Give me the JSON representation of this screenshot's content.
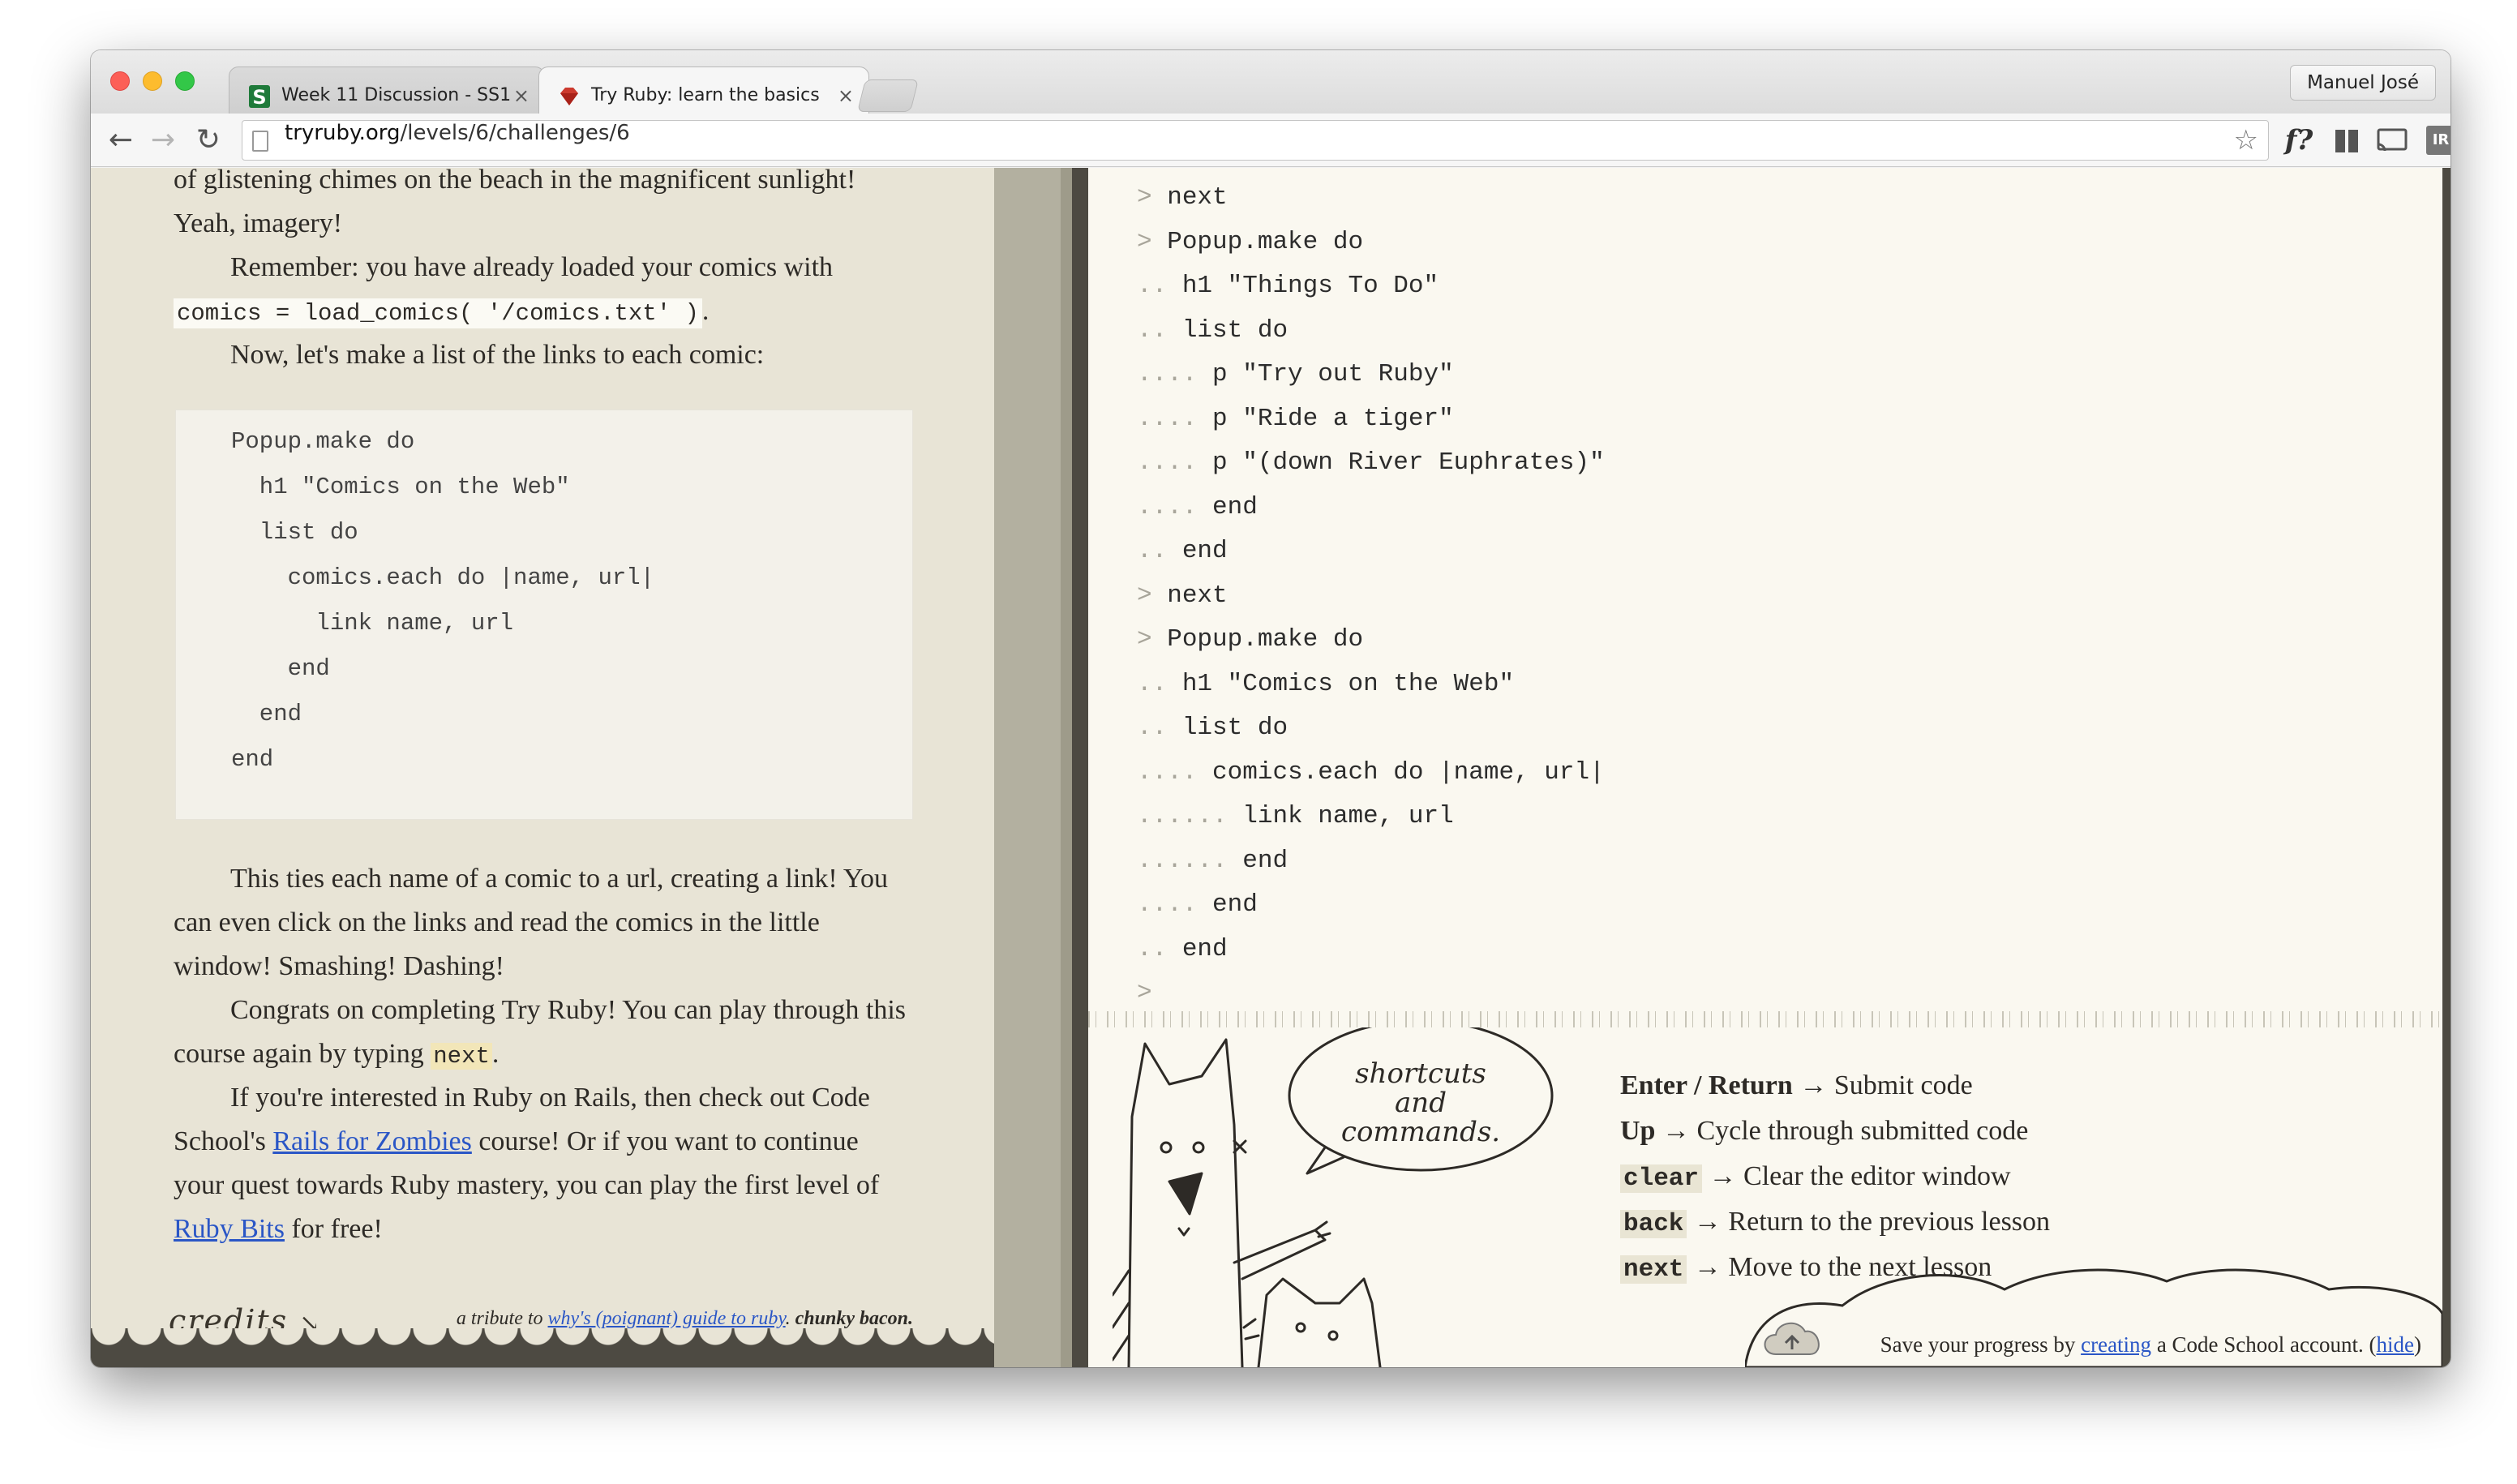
{
  "browser": {
    "tabs": [
      {
        "title": "Week 11 Discussion - SS1",
        "active": false
      },
      {
        "title": "Try Ruby: learn the basics",
        "active": true
      }
    ],
    "profile_name": "Manuel José",
    "url_domain": "tryruby.org",
    "url_path": "/levels/6/challenges/6",
    "ext_f": "f?",
    "ext_ir": "IR"
  },
  "lesson": {
    "para0": "of glistening chimes on the beach in the magnificent sunlight! Yeah, imagery!",
    "para1": "Remember: you have already loaded your comics with",
    "para1_code": "comics = load_comics( '/comics.txt' )",
    "para1_end": ".",
    "para2": "Now, let's make a list of the links to each comic:",
    "code_lines": [
      "Popup.make do",
      "  h1 \"Comics on the Web\"",
      "  list do",
      "    comics.each do |name, url|",
      "      link name, url",
      "    end",
      "  end",
      "end"
    ],
    "para3": "This ties each name of a comic to a url, creating a link! You can even click on the links and read the comics in the little window! Smashing! Dashing!",
    "para4_a": "Congrats on completing Try Ruby! You can play through this course again by typing",
    "para4_kw": "next",
    "para4_b": ".",
    "para5_a": "If you're interested in Ruby on Rails, then check out Code School's",
    "para5_link1": "Rails for Zombies",
    "para5_b": "course! Or if you want to continue your quest towards Ruby mastery, you can play the first level of",
    "para5_link2": "Ruby Bits",
    "para5_c": "for free!",
    "credits": "credits",
    "tribute_a": "a tribute to",
    "tribute_link": "why's (poignant) guide to ruby",
    "tribute_b": ".",
    "tribute_c": "chunky bacon."
  },
  "console": {
    "lines": [
      {
        "prompt": ">",
        "code": "next"
      },
      {
        "prompt": ">",
        "code": "Popup.make do"
      },
      {
        "prompt": "..",
        "code": "h1 \"Things To Do\""
      },
      {
        "prompt": "..",
        "code": "list do"
      },
      {
        "prompt": "....",
        "code": "p \"Try out Ruby\""
      },
      {
        "prompt": "....",
        "code": "p \"Ride a tiger\""
      },
      {
        "prompt": "....",
        "code": "p \"(down River Euphrates)\""
      },
      {
        "prompt": "....",
        "code": "end"
      },
      {
        "prompt": "..",
        "code": "end"
      },
      {
        "prompt": ">",
        "code": "next"
      },
      {
        "prompt": ">",
        "code": "Popup.make do"
      },
      {
        "prompt": "..",
        "code": "h1 \"Comics on the Web\""
      },
      {
        "prompt": "..",
        "code": "list do"
      },
      {
        "prompt": "....",
        "code": "comics.each do |name, url|"
      },
      {
        "prompt": "......",
        "code": "link name, url"
      },
      {
        "prompt": "......",
        "code": "end"
      },
      {
        "prompt": "....",
        "code": "end"
      },
      {
        "prompt": "..",
        "code": "end"
      },
      {
        "prompt": ">",
        "code": ""
      }
    ]
  },
  "help": {
    "bubble": [
      "shortcuts",
      "and",
      "commands."
    ],
    "shortcuts": [
      {
        "key": "Enter / Return",
        "desc": "Submit code",
        "mono": false
      },
      {
        "key": "Up",
        "desc": "Cycle through submitted code",
        "mono": false
      },
      {
        "key": "clear",
        "desc": "Clear the editor window",
        "mono": true
      },
      {
        "key": "back",
        "desc": "Return to the previous lesson",
        "mono": true
      },
      {
        "key": "next",
        "desc": "Move to the next lesson",
        "mono": true
      }
    ]
  },
  "save_banner": {
    "text_a": "Save your progress by",
    "link": "creating",
    "text_b": "a Code School account. (",
    "hide": "hide",
    "text_c": ")"
  },
  "colors": {
    "link": "#2a56c6",
    "paper": "#e8e4d6",
    "console_bg": "#faf8f0",
    "frame": "#4d4a42"
  }
}
